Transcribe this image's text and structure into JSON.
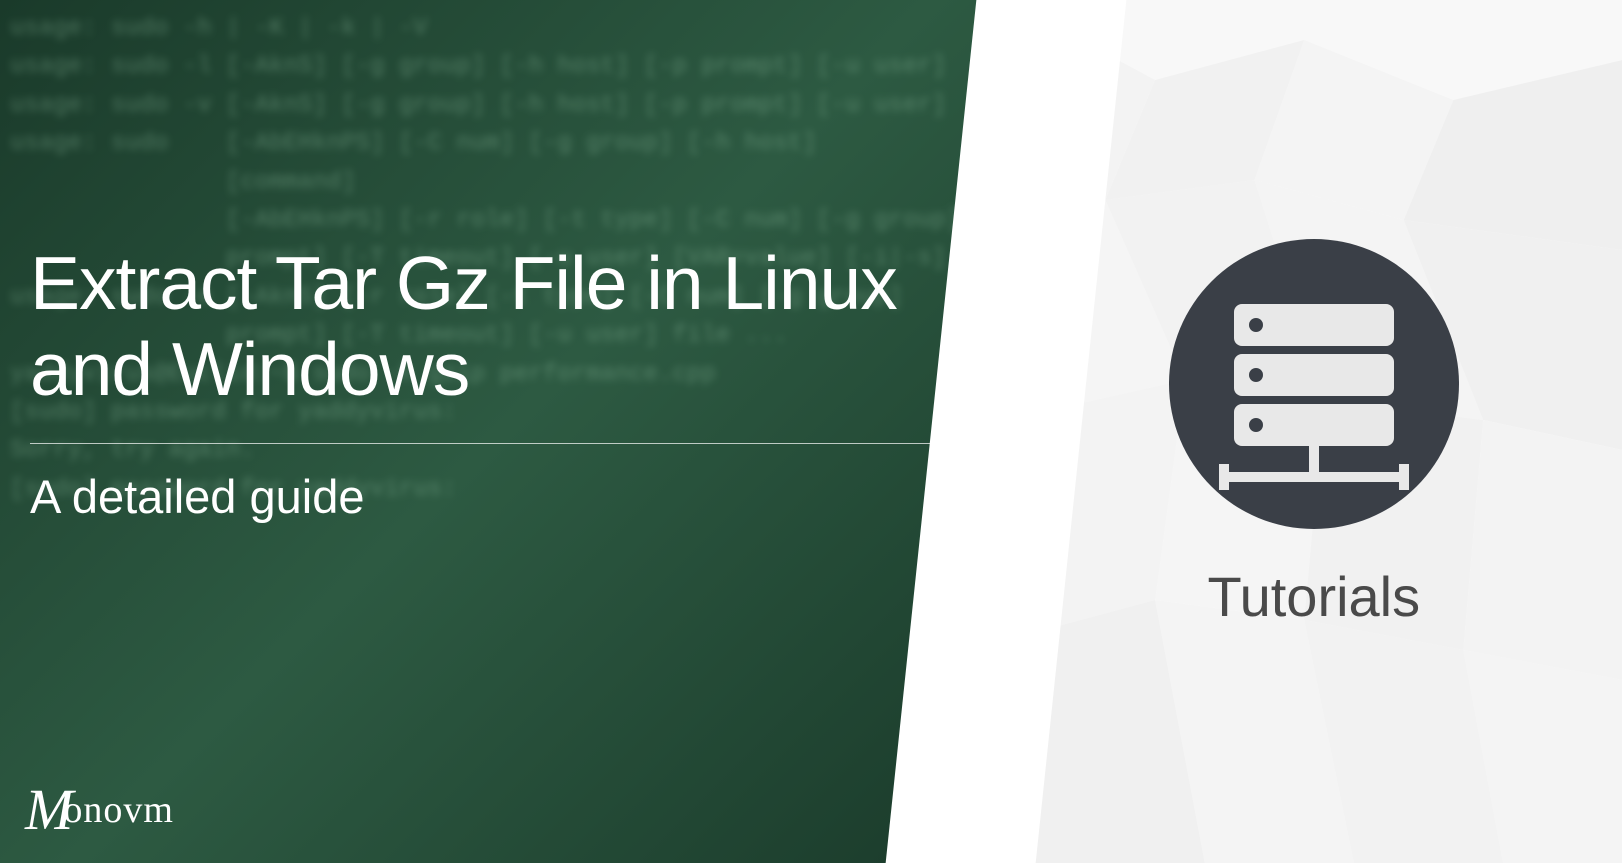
{
  "title": "Extract Tar Gz File in Linux and Windows",
  "subtitle": "A detailed guide",
  "logo": {
    "prefix": "M",
    "text": "onovm"
  },
  "category_label": "Tutorials",
  "icon_name": "server-icon",
  "terminal_text": "usage: sudo -h | -K | -k | -V\nusage: sudo -l [-AknS] [-g group] [-h host] [-p prompt] [-u user]\nusage: sudo -v [-AknS] [-g group] [-h host] [-p prompt] [-u user]\nusage: sudo    [-AbEHknPS] [-C num] [-g group] [-h host]\n               [command]\n               [-AbEHknPS] [-r role] [-t type] [-C num] [-g group]\n               prompt] [-T timeout] [-u user] [VAR=value] [-i|-s]\nusage: sudo -e [-AknS] [-r role] [-t type] [-C num] [-g group]\n               prompt] [-T timeout] [-u user] file ...\nyaddyvirus@Euclid:~$ sudo -k gzip performance.cpp\n[sudo] password for yaddyvirus:\nSorry, try again.\n[sudo] password for yaddyvirus:"
}
